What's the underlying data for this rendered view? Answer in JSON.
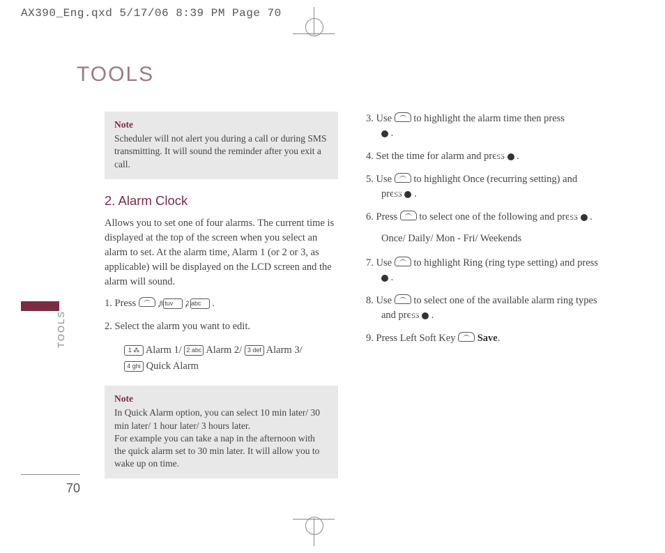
{
  "crop_header": "AX390_Eng.qxd  5/17/06  8:39 PM  Page 70",
  "page_title": "TOOLS",
  "side_tab": "TOOLS",
  "page_number": "70",
  "note1": {
    "title": "Note",
    "body": "Scheduler will not alert you during a call or during SMS transmitting. It will sound the reminder after you exit a call."
  },
  "section_heading": "2. Alarm Clock",
  "intro": "Allows you to set one of four alarms. The current time is displayed at the top of the screen when you select an alarm to set. At the alarm time, Alarm 1 (or 2 or 3, as applicable) will be displayed on the LCD screen and the alarm will sound.",
  "step1_a": "1. Press ",
  "step1_b": " , ",
  "step1_c": " , ",
  "step1_d": " .",
  "key_8tuv": "8 tuv",
  "key_2abc": "2 abc",
  "step2": "2. Select the alarm you want to edit.",
  "alarm_line1a": " Alarm 1/ ",
  "alarm_line1b": " Alarm 2/  ",
  "alarm_line1c": " Alarm 3/",
  "alarm_line2": " Quick Alarm",
  "key_1": "1 ⁂",
  "key_3def": "3 def",
  "key_4ghi": "4 ghi",
  "note2": {
    "title": "Note",
    "body": "In Quick Alarm option, you can select 10 min later/ 30 min later/ 1 hour later/ 3 hours later.\nFor example you can take a nap in the afternoon with the quick alarm set to 30 min later. It will allow you to wake up on time."
  },
  "ok_label": "OK",
  "r_step3a": "3. Use ",
  "r_step3b": " to highlight the alarm time then press ",
  "r_step3c": " .",
  "r_step4a": "4. Set the time for alarm and press ",
  "r_step4b": " .",
  "r_step5a": "5. Use ",
  "r_step5b": " to highlight Once (recurring setting) and press ",
  "r_step5c": " .",
  "r_step6a": "6. Press ",
  "r_step6b": " to select one of the following and press ",
  "r_step6c": " .",
  "options": "Once/ Daily/ Mon - Fri/ Weekends",
  "r_step7a": "7.  Use ",
  "r_step7b": " to highlight Ring (ring type setting) and press ",
  "r_step7c": " .",
  "r_step8a": "8. Use ",
  "r_step8b": " to select one of the available alarm ring types and press ",
  "r_step8c": " .",
  "r_step9a": "9. Press Left Soft Key ",
  "r_step9b": " ",
  "save": "Save",
  "r_step9c": "."
}
